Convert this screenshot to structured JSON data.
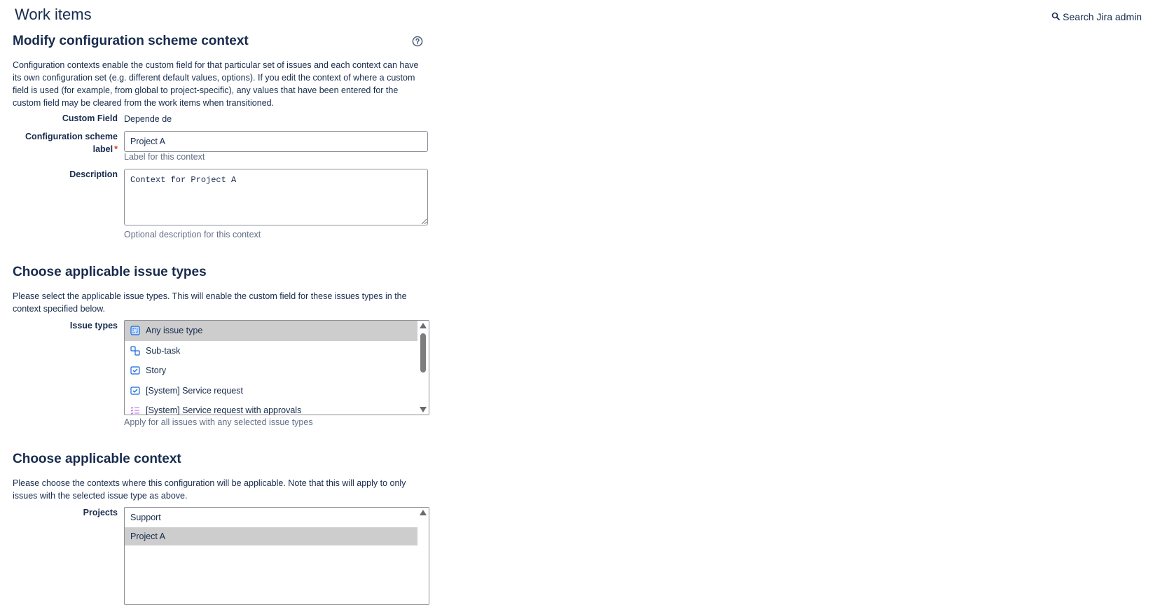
{
  "header": {
    "title": "Work items",
    "search_label": "Search Jira admin"
  },
  "context_section": {
    "heading": "Modify configuration scheme context",
    "description": "Configuration contexts enable the custom field for that particular set of issues and each context can have its own configuration set (e.g. different default values, options). If you edit the context of where a custom field is used (for example, from global to project-specific), any values that have been entered for the custom field may be cleared from the work items when transitioned.",
    "custom_field_label": "Custom Field",
    "custom_field_value": "Depende de",
    "scheme_label_label": "Configuration scheme label",
    "scheme_label_value": "Project A",
    "scheme_label_help": "Label for this context",
    "description_label": "Description",
    "description_value": "Context for Project A",
    "description_help": "Optional description for this context"
  },
  "issue_types_section": {
    "heading": "Choose applicable issue types",
    "description": "Please select the applicable issue types. This will enable the custom field for these issues types in the context specified below.",
    "field_label": "Issue types",
    "options": [
      {
        "label": "Any issue type",
        "icon": "any-issue-type-icon",
        "selected": true
      },
      {
        "label": "Sub-task",
        "icon": "subtask-icon",
        "selected": false
      },
      {
        "label": "Story",
        "icon": "story-icon",
        "selected": false
      },
      {
        "label": "[System] Service request",
        "icon": "service-request-icon",
        "selected": false
      },
      {
        "label": "[System] Service request with approvals",
        "icon": "service-request-approvals-icon",
        "selected": false
      }
    ],
    "help": "Apply for all issues with any selected issue types"
  },
  "context_choice_section": {
    "heading": "Choose applicable context",
    "description": "Please choose the contexts where this configuration will be applicable. Note that this will apply to only issues with the selected issue type as above.",
    "field_label": "Projects",
    "options": [
      {
        "label": "Support",
        "selected": false
      },
      {
        "label": "Project A",
        "selected": true
      }
    ]
  },
  "colors": {
    "text": "#172b4d",
    "subtle_text": "#626f86",
    "required": "#de350b",
    "selected_row": "#cdcdcd",
    "icon_blue": "#1868db",
    "icon_purple": "#bf63f3"
  }
}
